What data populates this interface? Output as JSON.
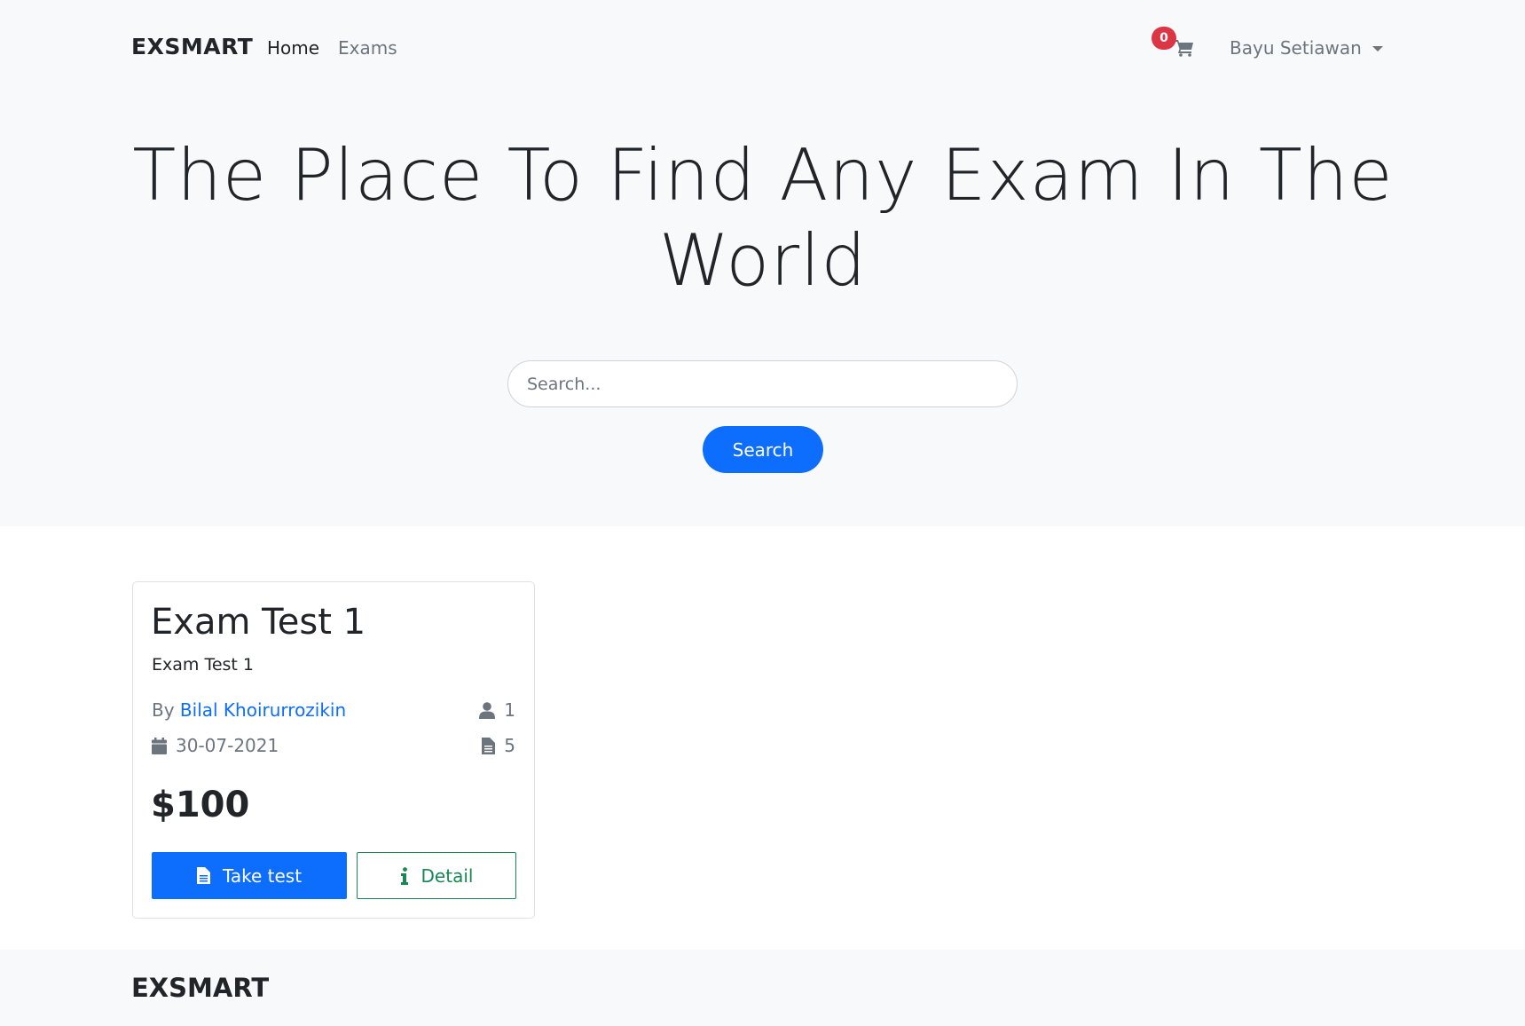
{
  "navbar": {
    "brand": "EXSMART",
    "links": [
      {
        "label": "Home",
        "active": true
      },
      {
        "label": "Exams",
        "active": false
      }
    ],
    "cart_count": "0",
    "user_name": "Bayu Setiawan"
  },
  "hero": {
    "title": "The Place To Find Any Exam In The World",
    "search_placeholder": "Search...",
    "search_value": "",
    "search_button_label": "Search"
  },
  "exam_card": {
    "title": "Exam Test 1",
    "description": "Exam Test 1",
    "author_prefix": "By",
    "author_name": "Bilal Khoirurrozikin",
    "date": "30-07-2021",
    "participants": "1",
    "questions": "5",
    "price": "$100",
    "take_button_label": "Take test",
    "detail_button_label": "Detail"
  },
  "footer": {
    "brand": "EXSMART"
  },
  "colors": {
    "primary": "#0d6efd",
    "success": "#198754",
    "danger": "#dc3545",
    "muted": "#6c757d",
    "light_bg": "#f8f9fa"
  }
}
